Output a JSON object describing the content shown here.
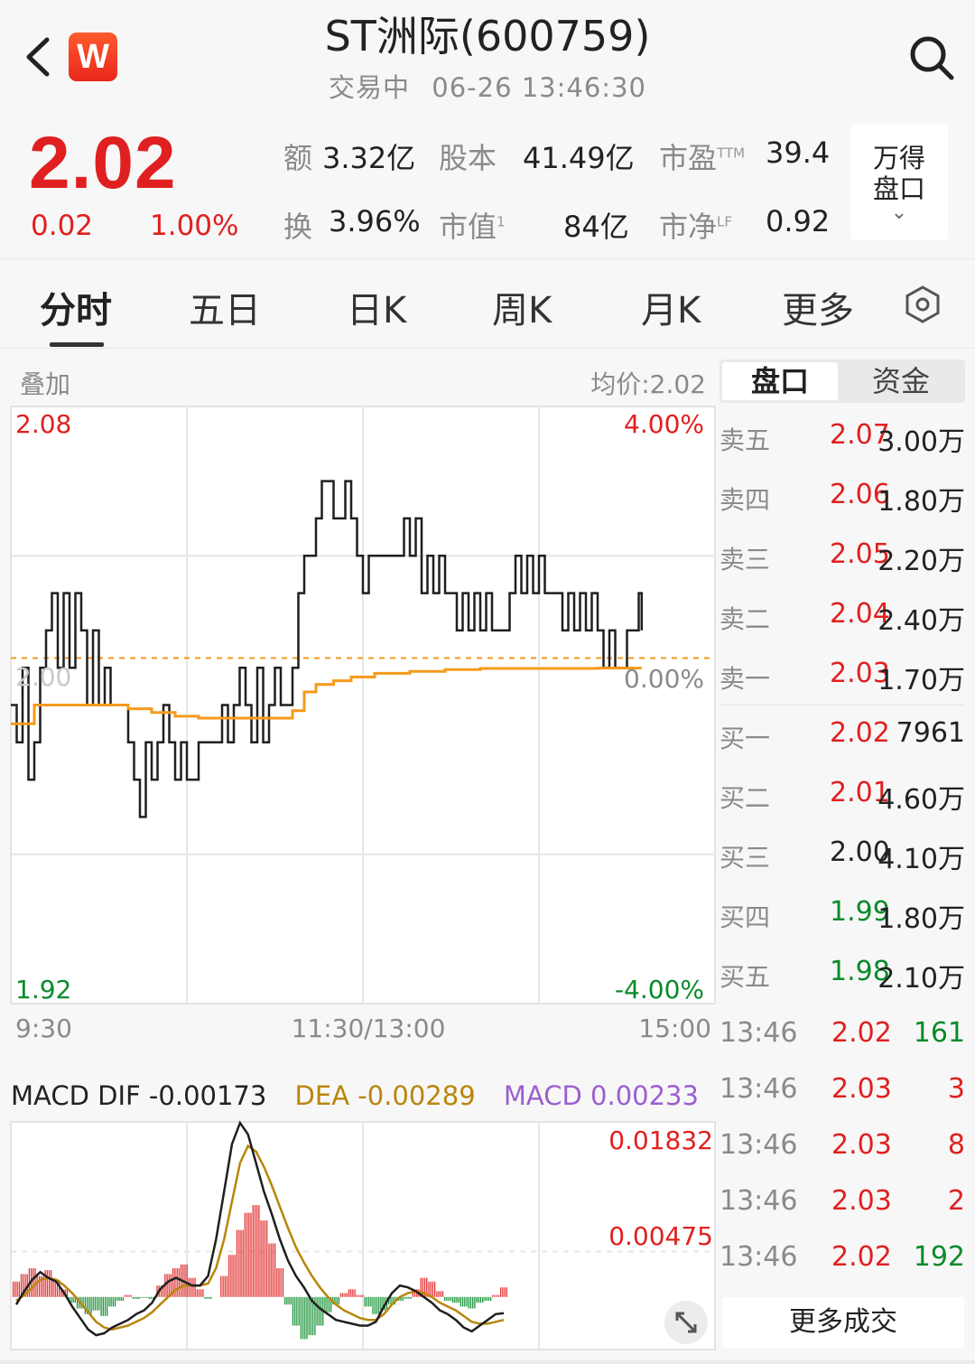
{
  "header": {
    "title": "ST洲际(600759)",
    "status": "交易中",
    "datetime": "06-26 13:46:30",
    "logo_letter": "W"
  },
  "quote": {
    "price": "2.02",
    "change": "0.02",
    "change_pct": "1.00%",
    "stats": [
      {
        "label": "额",
        "value": "3.32亿",
        "sup": ""
      },
      {
        "label": "股本",
        "value": "41.49亿",
        "sup": ""
      },
      {
        "label": "市盈",
        "value": "39.4",
        "sup": "TTM"
      },
      {
        "label": "换",
        "value": "3.96%",
        "sup": ""
      },
      {
        "label": "市值",
        "value": "84亿",
        "sup": "1"
      },
      {
        "label": "市净",
        "value": "0.92",
        "sup": "LF"
      }
    ],
    "wande_line1": "万得",
    "wande_line2": "盘口"
  },
  "tabs": [
    {
      "label": "分时",
      "active": true
    },
    {
      "label": "五日",
      "active": false
    },
    {
      "label": "日K",
      "active": false
    },
    {
      "label": "周K",
      "active": false
    },
    {
      "label": "月K",
      "active": false
    },
    {
      "label": "更多",
      "active": false
    }
  ],
  "chart_header": {
    "overlay": "叠加",
    "avg_price": "均价:2.02"
  },
  "colors": {
    "up": "#e02020",
    "down": "#0a8a2a",
    "price_line": "#1f1f1f",
    "avg_line": "#f59a1b",
    "dea_line": "#b8860b",
    "macd_label": "#9b5fd0"
  },
  "chart_data": [
    {
      "type": "line",
      "y_left_labels": {
        "top": "2.08",
        "bottom": "1.92",
        "mid": "2.00"
      },
      "y_right_labels": {
        "top": "4.00%",
        "mid": "0.00%",
        "bottom": "-4.00%"
      },
      "x_labels": [
        "9:30",
        "11:30/13:00",
        "15:00"
      ],
      "ylim": [
        1.92,
        2.08
      ],
      "prev_close": 2.0,
      "xlim_minutes": [
        0,
        240
      ],
      "series": [
        {
          "key": "price",
          "points": [
            [
              0,
              2.0
            ],
            [
              2,
              1.99
            ],
            [
              4,
              2.01
            ],
            [
              6,
              1.98
            ],
            [
              8,
              1.99
            ],
            [
              10,
              2.01
            ],
            [
              12,
              2.02
            ],
            [
              14,
              2.03
            ],
            [
              16,
              2.01
            ],
            [
              18,
              2.03
            ],
            [
              20,
              2.01
            ],
            [
              22,
              2.03
            ],
            [
              24,
              2.02
            ],
            [
              26,
              2.0
            ],
            [
              28,
              2.02
            ],
            [
              30,
              2.0
            ],
            [
              32,
              2.01
            ],
            [
              34,
              2.0
            ],
            [
              36,
              2.0
            ],
            [
              38,
              2.0
            ],
            [
              40,
              1.99
            ],
            [
              42,
              1.98
            ],
            [
              44,
              1.97
            ],
            [
              46,
              1.99
            ],
            [
              48,
              1.98
            ],
            [
              50,
              1.99
            ],
            [
              52,
              2.0
            ],
            [
              54,
              1.99
            ],
            [
              56,
              1.98
            ],
            [
              58,
              1.99
            ],
            [
              60,
              1.98
            ],
            [
              62,
              1.98
            ],
            [
              64,
              1.99
            ],
            [
              66,
              1.99
            ],
            [
              68,
              1.99
            ],
            [
              70,
              1.99
            ],
            [
              72,
              2.0
            ],
            [
              74,
              1.99
            ],
            [
              76,
              2.0
            ],
            [
              78,
              2.01
            ],
            [
              80,
              2.0
            ],
            [
              82,
              1.99
            ],
            [
              84,
              2.01
            ],
            [
              86,
              1.99
            ],
            [
              88,
              2.0
            ],
            [
              90,
              2.01
            ],
            [
              92,
              2.0
            ],
            [
              94,
              2.0
            ],
            [
              96,
              2.01
            ],
            [
              98,
              2.03
            ],
            [
              100,
              2.04
            ],
            [
              102,
              2.04
            ],
            [
              104,
              2.05
            ],
            [
              106,
              2.06
            ],
            [
              108,
              2.06
            ],
            [
              110,
              2.05
            ],
            [
              112,
              2.05
            ],
            [
              114,
              2.06
            ],
            [
              116,
              2.05
            ],
            [
              118,
              2.04
            ],
            [
              120,
              2.03
            ],
            [
              122,
              2.04
            ],
            [
              124,
              2.04
            ],
            [
              126,
              2.04
            ],
            [
              128,
              2.04
            ],
            [
              130,
              2.04
            ],
            [
              132,
              2.04
            ],
            [
              134,
              2.05
            ],
            [
              136,
              2.04
            ],
            [
              138,
              2.05
            ],
            [
              140,
              2.03
            ],
            [
              142,
              2.04
            ],
            [
              144,
              2.03
            ],
            [
              146,
              2.04
            ],
            [
              148,
              2.03
            ],
            [
              150,
              2.03
            ],
            [
              152,
              2.02
            ],
            [
              154,
              2.03
            ],
            [
              156,
              2.02
            ],
            [
              158,
              2.03
            ],
            [
              160,
              2.02
            ],
            [
              162,
              2.03
            ],
            [
              164,
              2.02
            ],
            [
              166,
              2.02
            ],
            [
              168,
              2.02
            ],
            [
              170,
              2.03
            ],
            [
              172,
              2.04
            ],
            [
              174,
              2.03
            ],
            [
              176,
              2.04
            ],
            [
              178,
              2.03
            ],
            [
              180,
              2.04
            ],
            [
              182,
              2.03
            ],
            [
              184,
              2.03
            ],
            [
              186,
              2.03
            ],
            [
              188,
              2.02
            ],
            [
              190,
              2.03
            ],
            [
              192,
              2.02
            ],
            [
              194,
              2.03
            ],
            [
              196,
              2.02
            ],
            [
              198,
              2.03
            ],
            [
              200,
              2.02
            ],
            [
              202,
              2.01
            ],
            [
              204,
              2.02
            ],
            [
              206,
              2.01
            ],
            [
              208,
              2.01
            ],
            [
              210,
              2.02
            ],
            [
              212,
              2.02
            ],
            [
              214,
              2.03
            ],
            [
              215,
              2.02
            ]
          ]
        },
        {
          "key": "avg",
          "points": [
            [
              0,
              1.995
            ],
            [
              4,
              1.995
            ],
            [
              8,
              2.0
            ],
            [
              12,
              2.0
            ],
            [
              16,
              2.0
            ],
            [
              24,
              2.0
            ],
            [
              28,
              2.0
            ],
            [
              36,
              2.0
            ],
            [
              40,
              1.999
            ],
            [
              48,
              1.998
            ],
            [
              56,
              1.997
            ],
            [
              64,
              1.9965
            ],
            [
              72,
              1.9965
            ],
            [
              80,
              1.9965
            ],
            [
              88,
              1.9965
            ],
            [
              92,
              1.9965
            ],
            [
              96,
              1.9985
            ],
            [
              100,
              2.0035
            ],
            [
              104,
              2.0055
            ],
            [
              110,
              2.0065
            ],
            [
              116,
              2.0075
            ],
            [
              124,
              2.0085
            ],
            [
              136,
              2.009
            ],
            [
              148,
              2.0095
            ],
            [
              160,
              2.0098
            ],
            [
              176,
              2.0098
            ],
            [
              200,
              2.0099
            ],
            [
              215,
              2.0099
            ]
          ]
        }
      ]
    },
    {
      "type": "bar",
      "name": "MACD",
      "legend": {
        "dif": "MACD DIF -0.00173",
        "dea": "DEA -0.00289",
        "macd": "MACD 0.00233"
      },
      "y_labels": {
        "top": "0.01832",
        "mid": "0.00475"
      },
      "ylim": [
        -0.0055,
        0.0183
      ],
      "macd_hist": [
        0.0016,
        0.0024,
        0.003,
        0.0022,
        0.0028,
        0.0018,
        0.0008,
        -0.0006,
        -0.0012,
        -0.0018,
        -0.0014,
        -0.002,
        -0.001,
        -0.0004,
        0.0002,
        -0.0002,
        -0.0001,
        -0.0002,
        0.0012,
        0.0024,
        0.003,
        0.0034,
        0.002,
        0.0008,
        -0.0002,
        0.0,
        0.0022,
        0.0044,
        0.007,
        0.0088,
        0.0096,
        0.008,
        0.0056,
        0.003,
        -0.0008,
        -0.003,
        -0.0044,
        -0.004,
        -0.003,
        -0.0016,
        -0.0008,
        0.0004,
        0.0008,
        0.0002,
        -0.001,
        -0.0018,
        -0.0014,
        -0.0008,
        -0.0004,
        -0.0002,
        0.0008,
        0.002,
        0.0016,
        0.0006,
        -0.0004,
        -0.0006,
        -0.001,
        -0.0012,
        -0.0006,
        -0.0004,
        0.0002,
        0.001
      ],
      "dif": [
        -0.0008,
        0.0006,
        0.0018,
        0.0026,
        0.002,
        0.0016,
        0.0004,
        -0.001,
        -0.0022,
        -0.0034,
        -0.004,
        -0.0038,
        -0.0032,
        -0.0028,
        -0.0024,
        -0.0018,
        -0.0014,
        -0.0006,
        0.0008,
        0.0016,
        0.002,
        0.0016,
        0.0012,
        0.0012,
        0.0022,
        0.006,
        0.011,
        0.016,
        0.0182,
        0.017,
        0.014,
        0.011,
        0.0086,
        0.006,
        0.0038,
        0.0022,
        0.001,
        -0.0004,
        -0.0012,
        -0.0018,
        -0.0024,
        -0.0026,
        -0.0028,
        -0.003,
        -0.003,
        -0.0026,
        -0.001,
        0.0004,
        0.0012,
        0.001,
        0.0006,
        0.0,
        -0.0006,
        -0.0014,
        -0.0018,
        -0.0024,
        -0.0032,
        -0.0036,
        -0.003,
        -0.0024,
        -0.0018,
        -0.0017
      ],
      "dea": [
        -0.0004,
        0.0002,
        0.001,
        0.0018,
        0.002,
        0.0018,
        0.0012,
        0.0004,
        -0.0006,
        -0.0016,
        -0.0026,
        -0.0032,
        -0.0034,
        -0.0032,
        -0.003,
        -0.0026,
        -0.0022,
        -0.0016,
        -0.0008,
        0.0,
        0.0008,
        0.0012,
        0.0012,
        0.0012,
        0.0014,
        0.003,
        0.006,
        0.01,
        0.014,
        0.0158,
        0.0152,
        0.0136,
        0.0116,
        0.0094,
        0.0072,
        0.0052,
        0.0036,
        0.0022,
        0.001,
        0.0,
        -0.0008,
        -0.0014,
        -0.0018,
        -0.0022,
        -0.0024,
        -0.0024,
        -0.0018,
        -0.0008,
        0.0,
        0.0004,
        0.0006,
        0.0004,
        0.0,
        -0.0006,
        -0.001,
        -0.0014,
        -0.002,
        -0.0026,
        -0.0028,
        -0.0028,
        -0.0026,
        -0.0024
      ]
    }
  ],
  "right_panel": {
    "tab_pankou": "盘口",
    "tab_zijin": "资金",
    "asks": [
      {
        "label": "卖五",
        "price": "2.07",
        "vol": "3.00万",
        "dir": "up"
      },
      {
        "label": "卖四",
        "price": "2.06",
        "vol": "1.80万",
        "dir": "up"
      },
      {
        "label": "卖三",
        "price": "2.05",
        "vol": "2.20万",
        "dir": "up"
      },
      {
        "label": "卖二",
        "price": "2.04",
        "vol": "2.40万",
        "dir": "up"
      },
      {
        "label": "卖一",
        "price": "2.03",
        "vol": "1.70万",
        "dir": "up"
      }
    ],
    "bids": [
      {
        "label": "买一",
        "price": "2.02",
        "vol": "7961",
        "dir": "up"
      },
      {
        "label": "买二",
        "price": "2.01",
        "vol": "4.60万",
        "dir": "up"
      },
      {
        "label": "买三",
        "price": "2.00",
        "vol": "4.10万",
        "dir": "flat"
      },
      {
        "label": "买四",
        "price": "1.99",
        "vol": "1.80万",
        "dir": "down"
      },
      {
        "label": "买五",
        "price": "1.98",
        "vol": "2.10万",
        "dir": "down"
      }
    ],
    "ticks": [
      {
        "time": "13:46",
        "price": "2.02",
        "vol": "161",
        "pdir": "up",
        "vdir": "down"
      },
      {
        "time": "13:46",
        "price": "2.03",
        "vol": "3",
        "pdir": "up",
        "vdir": "up"
      },
      {
        "time": "13:46",
        "price": "2.03",
        "vol": "8",
        "pdir": "up",
        "vdir": "up"
      },
      {
        "time": "13:46",
        "price": "2.03",
        "vol": "2",
        "pdir": "up",
        "vdir": "up"
      },
      {
        "time": "13:46",
        "price": "2.02",
        "vol": "192",
        "pdir": "up",
        "vdir": "down"
      }
    ],
    "more_trades": "更多成交"
  }
}
